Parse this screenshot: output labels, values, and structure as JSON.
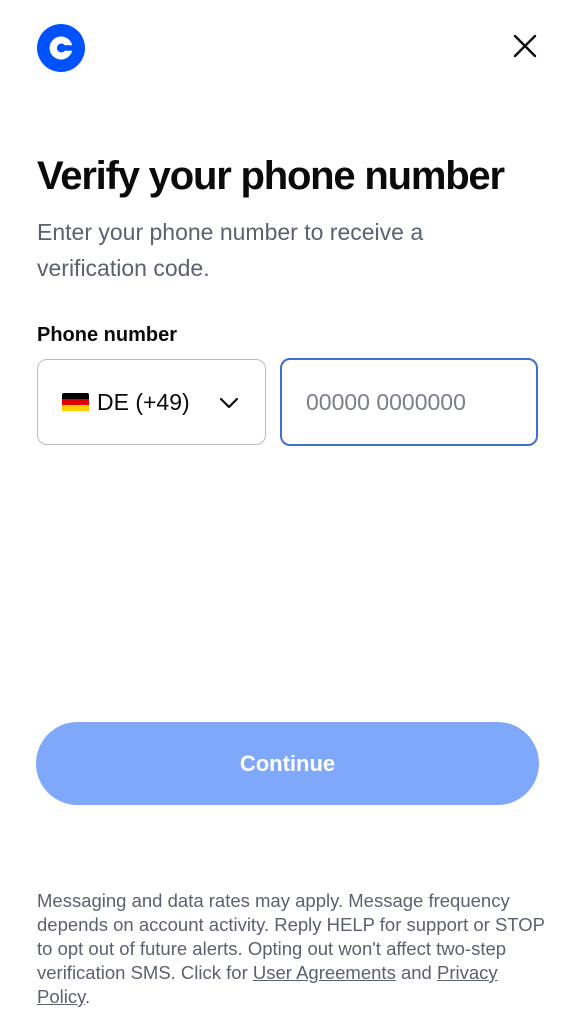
{
  "header": {
    "logo_icon": "coinbase-logo-icon",
    "close_icon": "close-icon"
  },
  "page": {
    "title": "Verify your phone number",
    "subtitle": "Enter your phone number to receive a verification code."
  },
  "phone_form": {
    "label": "Phone number",
    "country": {
      "flag_icon": "germany-flag-icon",
      "selected": "DE (+49)"
    },
    "number": {
      "value": "",
      "placeholder": "00000 0000000"
    }
  },
  "actions": {
    "continue_label": "Continue"
  },
  "disclaimer": {
    "text": "Messaging and data rates may apply. Message frequency depends on account activity. Reply HELP for support or STOP to opt out of future alerts. Opting out won't affect two-step verification SMS. Click for ",
    "user_agreements_label": "User Agreements",
    "conjunction": " and ",
    "privacy_policy_label": "Privacy Policy",
    "end": "."
  },
  "colors": {
    "brand_blue": "#0052ff",
    "focus_border": "#3e6fd8",
    "button_disabled": "#7fa8fb",
    "text_primary": "#0a0b0d",
    "text_secondary": "#5b616e"
  }
}
